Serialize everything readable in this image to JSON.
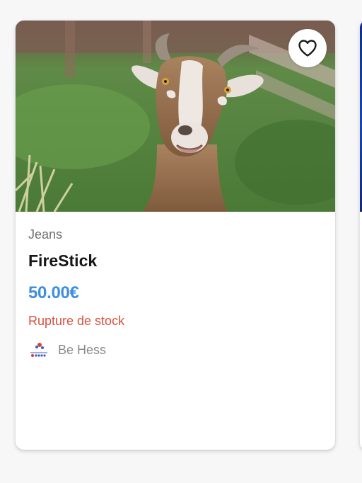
{
  "product_card": {
    "image_alt": "goat photo",
    "favorite_icon": "heart-outline-icon",
    "category": "Jeans",
    "title": "FireStick",
    "price": "50.00€",
    "stock_status": "Rupture de stock",
    "seller": {
      "logo_icon": "seller-logo-icon",
      "name": "Be Hess"
    }
  },
  "colors": {
    "price": "#3f8ee0",
    "stock_status": "#d9503f",
    "category": "#6f6f6f",
    "seller_name": "#8a8a8a",
    "next_card_image": "#1943b8"
  }
}
